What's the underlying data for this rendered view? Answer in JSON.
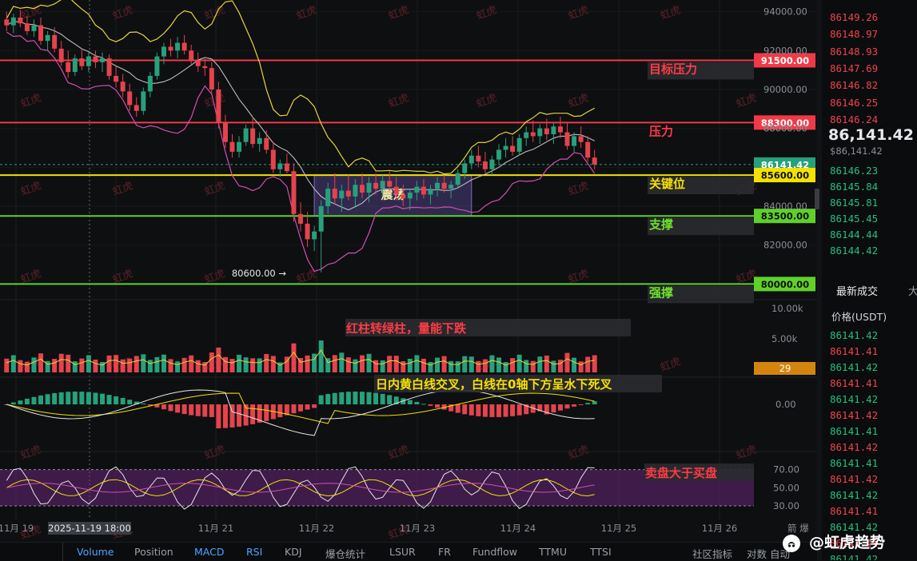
{
  "chart_data": {
    "type": "candlestick",
    "price_axis": {
      "ticks": [
        "94000.00",
        "92000.00",
        "90000.00",
        "88000.00",
        "84000.00",
        "82000.00"
      ],
      "ylim": [
        79400,
        94600
      ]
    },
    "time_axis": {
      "labels": [
        "11月 19",
        "11月 21",
        "11月 22",
        "11月 23",
        "11月 24",
        "11月 25",
        "11月 26"
      ],
      "crosshair_label": "2025-11-19 18:00"
    },
    "levels": [
      {
        "price": 91500,
        "label": "91500.00",
        "annotation": "目标压力",
        "color": "#f03a47"
      },
      {
        "price": 88300,
        "label": "88300.00",
        "annotation": "压力",
        "color": "#f03a47"
      },
      {
        "price": 86141.42,
        "label": "86141.42",
        "annotation": "",
        "color": "#26a17b"
      },
      {
        "price": 85600,
        "label": "85600.00",
        "annotation": "关键位",
        "color": "#f2e200"
      },
      {
        "price": 83500,
        "label": "83500.00",
        "annotation": "支撑",
        "color": "#5fd12a"
      },
      {
        "price": 80000,
        "label": "80000.00",
        "annotation": "强撑",
        "color": "#5fd12a"
      }
    ],
    "annotations": {
      "range_box": "震荡",
      "low_marker": "80600.00"
    },
    "candles": [
      [
        93600,
        94000,
        93000,
        93300
      ],
      [
        93300,
        93900,
        92900,
        93700
      ],
      [
        93700,
        94100,
        93200,
        93400
      ],
      [
        93400,
        93800,
        92800,
        93000
      ],
      [
        93000,
        93600,
        92700,
        93300
      ],
      [
        93300,
        93700,
        92300,
        92500
      ],
      [
        92500,
        93000,
        92000,
        92800
      ],
      [
        92800,
        93200,
        91900,
        92100
      ],
      [
        92100,
        92500,
        91200,
        91400
      ],
      [
        91400,
        92000,
        90600,
        90900
      ],
      [
        90900,
        91800,
        90700,
        91600
      ],
      [
        91600,
        92100,
        91000,
        91200
      ],
      [
        91200,
        91900,
        90900,
        91700
      ],
      [
        91700,
        92000,
        91100,
        91400
      ],
      [
        91400,
        91900,
        90900,
        91600
      ],
      [
        91600,
        91800,
        90500,
        90700
      ],
      [
        90700,
        91200,
        90100,
        90400
      ],
      [
        90400,
        90800,
        89600,
        89900
      ],
      [
        89900,
        90300,
        88900,
        89200
      ],
      [
        89200,
        89600,
        88600,
        88900
      ],
      [
        88900,
        90100,
        88700,
        89900
      ],
      [
        89900,
        90900,
        89600,
        90700
      ],
      [
        90700,
        91900,
        90500,
        91700
      ],
      [
        91700,
        92400,
        91300,
        92200
      ],
      [
        92200,
        92600,
        91700,
        92000
      ],
      [
        92000,
        92700,
        91600,
        92400
      ],
      [
        92400,
        92800,
        91800,
        92000
      ],
      [
        92000,
        92300,
        91300,
        91500
      ],
      [
        91500,
        91900,
        90900,
        91200
      ],
      [
        91200,
        91600,
        90700,
        91100
      ],
      [
        91100,
        91400,
        89800,
        90000
      ],
      [
        90000,
        90400,
        88000,
        88300
      ],
      [
        88300,
        88700,
        87000,
        87300
      ],
      [
        87300,
        87700,
        86500,
        86800
      ],
      [
        86800,
        87600,
        86500,
        87300
      ],
      [
        87300,
        88200,
        87100,
        88000
      ],
      [
        88000,
        88600,
        87000,
        87200
      ],
      [
        87200,
        87800,
        86800,
        87500
      ],
      [
        87500,
        87900,
        86700,
        86900
      ],
      [
        86900,
        87300,
        85700,
        85900
      ],
      [
        85900,
        86400,
        85500,
        86200
      ],
      [
        86200,
        86700,
        85700,
        85800
      ],
      [
        85800,
        86200,
        83200,
        83600
      ],
      [
        83600,
        84200,
        82700,
        83100
      ],
      [
        83100,
        83700,
        81900,
        82300
      ],
      [
        82300,
        83000,
        81700,
        82700
      ],
      [
        82700,
        84300,
        80600,
        84000
      ],
      [
        84000,
        85200,
        83600,
        84900
      ],
      [
        84900,
        85700,
        84100,
        84400
      ],
      [
        84400,
        85100,
        83700,
        84800
      ],
      [
        84800,
        85600,
        84300,
        84500
      ],
      [
        84500,
        85400,
        84000,
        85100
      ],
      [
        85100,
        85700,
        84400,
        84700
      ],
      [
        84700,
        85500,
        84200,
        85200
      ],
      [
        85200,
        85700,
        84600,
        84900
      ],
      [
        84900,
        85600,
        84500,
        85300
      ],
      [
        85300,
        85800,
        84800,
        85000
      ],
      [
        85000,
        85500,
        84300,
        84600
      ],
      [
        84600,
        85100,
        84000,
        84400
      ],
      [
        84400,
        84900,
        83800,
        84700
      ],
      [
        84700,
        85300,
        84300,
        85000
      ],
      [
        85000,
        85400,
        84400,
        84600
      ],
      [
        84600,
        85100,
        84100,
        84900
      ],
      [
        84900,
        85500,
        84500,
        85200
      ],
      [
        85200,
        85600,
        84700,
        84900
      ],
      [
        84900,
        85300,
        84400,
        85100
      ],
      [
        85100,
        85900,
        84900,
        85700
      ],
      [
        85700,
        86400,
        85400,
        86200
      ],
      [
        86200,
        86900,
        85900,
        86600
      ],
      [
        86600,
        87100,
        86000,
        86300
      ],
      [
        86300,
        86800,
        85700,
        85900
      ],
      [
        85900,
        86600,
        85600,
        86400
      ],
      [
        86400,
        87200,
        86100,
        86900
      ],
      [
        86900,
        87500,
        86500,
        87100
      ],
      [
        87100,
        87600,
        86600,
        86800
      ],
      [
        86800,
        87700,
        86600,
        87500
      ],
      [
        87500,
        88100,
        87100,
        87800
      ],
      [
        87800,
        88400,
        87300,
        87600
      ],
      [
        87600,
        88200,
        87200,
        88000
      ],
      [
        88000,
        88500,
        87400,
        87700
      ],
      [
        87700,
        88300,
        87200,
        88100
      ],
      [
        88100,
        88600,
        87500,
        87800
      ],
      [
        87800,
        88300,
        86900,
        87100
      ],
      [
        87100,
        87800,
        86800,
        87600
      ],
      [
        87600,
        88100,
        87000,
        87300
      ],
      [
        87300,
        87600,
        86300,
        86500
      ],
      [
        86500,
        86900,
        85900,
        86141
      ]
    ],
    "volume_axis": {
      "ticks": [
        "10.00k",
        "5.00k"
      ],
      "label": "29"
    },
    "macd_axis": {
      "ticks": [
        "0.00"
      ]
    },
    "rsi_axis": {
      "ticks": [
        "70.00",
        "50.00",
        "30.00"
      ]
    },
    "notes": [
      "红柱转绿柱，量能下跌",
      "日内黄白线交叉，白线在0轴下方呈水下死叉",
      "卖盘大于买盘"
    ]
  },
  "watermark": "虹虎",
  "orderbook": {
    "asks": [
      "86149.26",
      "86148.97",
      "86148.93",
      "86147.69",
      "86146.82",
      "86146.25",
      "86146.24"
    ],
    "last_price": "86,141.42",
    "last_price_sub": "$86,141.42",
    "bids": [
      "86146.23",
      "86145.84",
      "86145.81",
      "86145.45",
      "86144.44",
      "86144.42"
    ],
    "trades_header": "最新成交",
    "trades_header2": "大",
    "price_unit": "价格(USDT)",
    "trades": [
      "86141.42",
      "86141.41",
      "86141.42",
      "86141.41",
      "86141.42",
      "86141.42",
      "86141.41",
      "86141.42",
      "86141.41",
      "86141.42",
      "86141.42",
      "86141.41",
      "86141.42",
      "86141.41",
      "86141.42"
    ]
  },
  "toolbar": {
    "items": [
      "Volume",
      "Position",
      "MACD",
      "RSI",
      "KDJ",
      "爆仓统计",
      "LSUR",
      "FR",
      "Fundflow",
      "TTMU",
      "TTSI"
    ],
    "right_items": [
      "社区指标",
      "对数",
      "自动"
    ],
    "bottom_right_partial": "箭 爆"
  },
  "brand": "@虹虎趋势",
  "colors": {
    "up": "#26a17b",
    "down": "#e5434d",
    "background": "#0e0f11"
  }
}
